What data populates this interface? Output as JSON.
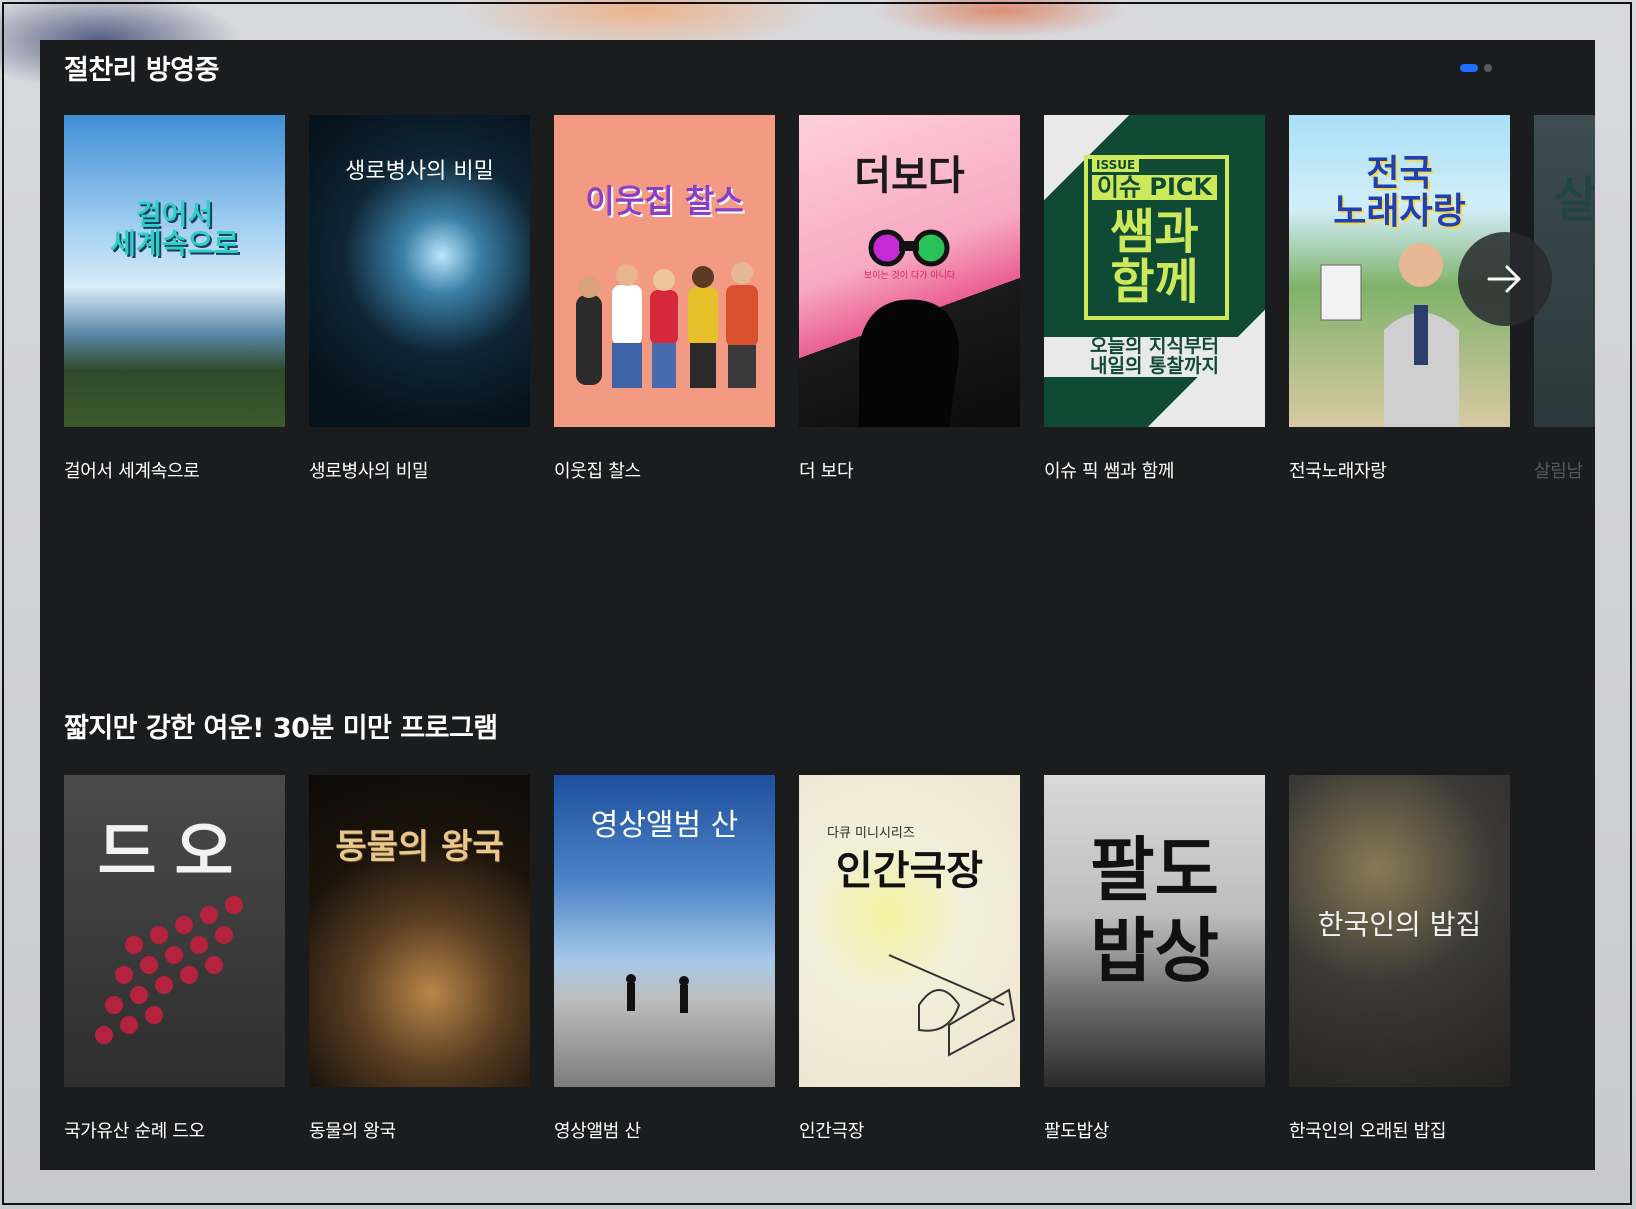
{
  "sections": [
    {
      "title": "절찬리 방영중",
      "items": [
        {
          "title": "걸어서 세계속으로",
          "poster_text": "걸어서\n세계속으로"
        },
        {
          "title": "생로병사의 비밀",
          "poster_text": "생로병사의 비밀"
        },
        {
          "title": "이웃집 찰스",
          "poster_text": "이웃집 찰스"
        },
        {
          "title": "더 보다",
          "poster_text": "더보다",
          "poster_sub": "보이는 것이 다가 아니다"
        },
        {
          "title": "이슈 픽 쌤과 함께",
          "poster_badge": "ISSUE",
          "poster_head": "이슈 PICK",
          "poster_text": "쌤과\n함께",
          "poster_sub": "오늘의 지식부터\n내일의 통찰까지"
        },
        {
          "title": "전국노래자랑",
          "poster_text": "전국\n노래자랑"
        },
        {
          "title": "살림남",
          "poster_text": "살"
        }
      ]
    },
    {
      "title": "짧지만 강한 여운! 30분 미만 프로그램",
      "items": [
        {
          "title": "국가유산 순례 드오",
          "poster_text": "드오"
        },
        {
          "title": "동물의 왕국",
          "poster_text": "동물의 왕국"
        },
        {
          "title": "영상앨범 산",
          "poster_text": "영상앨범 산"
        },
        {
          "title": "인간극장",
          "poster_sub": "다큐 미니시리즈",
          "poster_text": "인간극장"
        },
        {
          "title": "팔도밥상",
          "poster_text": "팔도\n밥상"
        },
        {
          "title": "한국인의 오래된 밥집",
          "poster_text": "한국인의 밥집"
        }
      ]
    }
  ],
  "carousel": {
    "pages": 2,
    "active_page": 1,
    "next_icon": "arrow-right-icon"
  },
  "colors": {
    "panel_bg": "#1b1c1e",
    "accent": "#1f6fff",
    "text": "#ffffff",
    "faded_text": "#55575b"
  }
}
